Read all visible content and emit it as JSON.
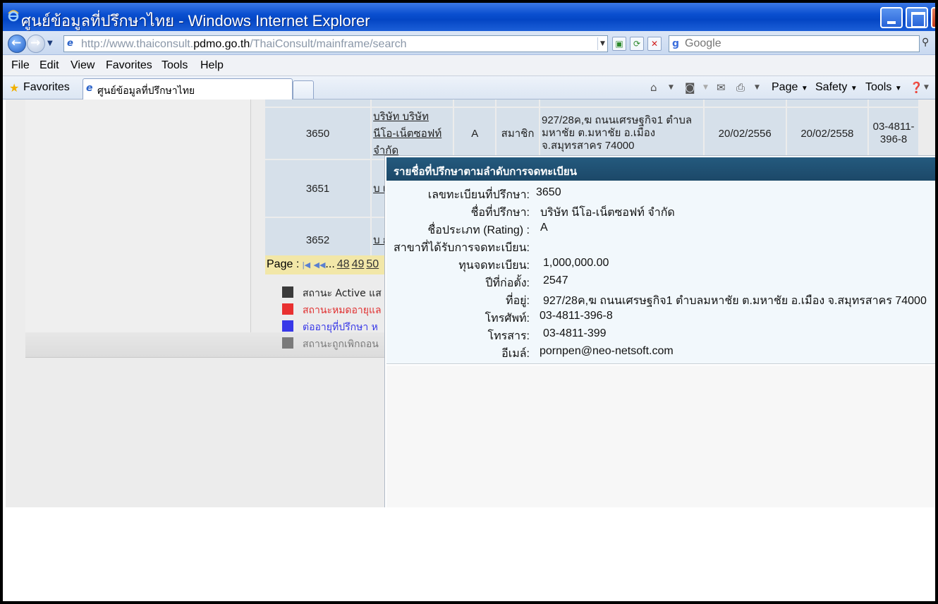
{
  "window": {
    "title": "ศูนย์ข้อมูลที่ปรึกษาไทย - Windows Internet Explorer"
  },
  "address": {
    "url_prefix": "http://www.thaiconsult.",
    "url_host": "pdmo.go.th",
    "url_path": "/ThaiConsult/mainframe/search",
    "search_placeholder": "Google"
  },
  "menu": [
    "File",
    "Edit",
    "View",
    "Favorites",
    "Tools",
    "Help"
  ],
  "favorites_label": "Favorites",
  "tab": {
    "label": "ศูนย์ข้อมูลที่ปรึกษาไทย"
  },
  "commands": {
    "page": "Page",
    "safety": "Safety",
    "tools": "Tools"
  },
  "table": {
    "rows": [
      {
        "id": "3650",
        "name": "บริษัท บริษัท นีโอ-เน็ตซอฟท์ จำกัด",
        "rating": "A",
        "type": "สมาชิก",
        "address": "927/28ค,ฆ ถนนเศรษฐกิจ1 ตำบลมหาชัย ต.มหาชัย อ.เมือง จ.สมุทรสาคร 74000",
        "date1": "20/02/2556",
        "date2": "20/02/2558",
        "phone": "03-4811-396-8"
      },
      {
        "id": "3651",
        "name": "บ เล ส"
      },
      {
        "id": "3652",
        "name": "บ ก เเ"
      }
    ]
  },
  "pager": {
    "label": "Page :",
    "ellipsis": "...",
    "pages": [
      "48",
      "49",
      "50"
    ]
  },
  "legend": [
    {
      "text": "สถานะ Active แส",
      "color": "#3a3a3a",
      "text_color": "#222222"
    },
    {
      "text": "สถานะหมดอายุแล",
      "color": "#e83030",
      "text_color": "#e03030"
    },
    {
      "text": "ต่ออายุที่ปรึกษา ห",
      "color": "#3838e8",
      "text_color": "#3838e8"
    },
    {
      "text": "สถานะถูกเพิกถอน",
      "color": "#7a7a7a",
      "text_color": "#7a7a7a"
    }
  ],
  "popup": {
    "title": "รายชื่อที่ปรึกษาตามลำดับการจดทะเบียน",
    "fields": [
      {
        "label": "เลขทะเบียนที่ปรึกษา:",
        "value": "3650"
      },
      {
        "label": "ชื่อที่ปรึกษา:",
        "value": "บริษัท นีโอ-เน็ตซอฟท์ จำกัด"
      },
      {
        "label": "ชื่อประเภท (Rating) :",
        "value": "A"
      },
      {
        "label": "สาขาที่ได้รับการจดทะเบียน:",
        "value": ""
      },
      {
        "label": "ทุนจดทะเบียน:",
        "value": "1,000,000.00"
      },
      {
        "label": "ปีที่ก่อตั้ง:",
        "value": "2547"
      },
      {
        "label": "ที่อยู่:",
        "value": "927/28ค,ฆ ถนนเศรษฐกิจ1 ตำบลมหาชัย ต.มหาชัย อ.เมือง จ.สมุทรสาคร 74000"
      },
      {
        "label": "โทรศัพท์:",
        "value": "03-4811-396-8"
      },
      {
        "label": "โทรสาร:",
        "value": "03-4811-399"
      },
      {
        "label": "อีเมล์:",
        "value": "pornpen@neo-netsoft.com"
      }
    ]
  }
}
